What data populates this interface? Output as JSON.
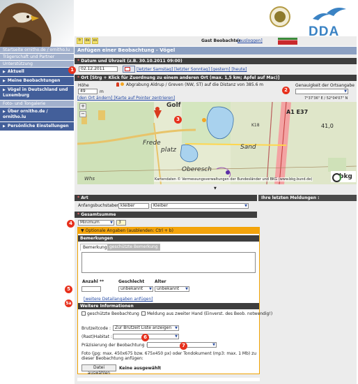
{
  "header": {
    "logo_text": "DDA"
  },
  "topbar": {
    "languages": [
      "fr",
      "de",
      "es"
    ],
    "guest_label": "Gast Beobachter",
    "logout_label": "[ausloggen]"
  },
  "sidebar": {
    "links": [
      "Startseite ornitho.de / ornitho.lu",
      "Trägerschaft und Partner",
      "Unterstützung"
    ],
    "nav1": [
      "Aktuell",
      "Meine Beobachtungen",
      "Vögel in Deutschland und Luxemburg"
    ],
    "group_label": "Foto- und Tongalerie",
    "nav2": [
      "Über ornitho.de / ornitho.lu",
      "Persönliche Einstellungen"
    ]
  },
  "page": {
    "title": "Anfügen einer Beobachtung - Vögel"
  },
  "date_section": {
    "heading": "Datum und Uhrzeit (z.B. 30.10.2011 09:00)",
    "date_value": "02.12.2011",
    "date_links": "[letzter Samstag] [letzter Sonntag] [gestern] [heute]"
  },
  "place_section": {
    "heading": "Ort [Strg + Klick für Zuordnung zu einem anderen Ort (max. 1,5 km; Apfel auf Mac)]",
    "height_label": "Höhe",
    "height_value": "49",
    "height_unit": "m",
    "location_text": "Abgrabung Aldrup / Greven (NW, ST) auf die Distanz von 385.6 m",
    "map_links": "[den Ort ändern] [Karte auf Pointer zentrieren]",
    "precision_label": "Genauigkeit der Ortsangabe",
    "coords": "7°37'36\" E / 52°04'07\" N",
    "map_labels": [
      "Golf",
      "Frede",
      "platz",
      "Sand",
      "Oberesch",
      "Whs",
      "K18",
      "A1 E37",
      "41,0"
    ],
    "map_copyright": "Kartendaten © Vermessungsverwaltungen der Bundesländer und BKG (www.bkg.bund.de)",
    "map_logo": "bkg"
  },
  "species_section": {
    "heading": "Art",
    "prefix_label": "Anfangsbuchstaben",
    "prefix_value": "kleiber",
    "species_value": "Kleiber",
    "last_reports": "Ihre letzten Meldungen :"
  },
  "count_section": {
    "heading": "Gesamtsumme",
    "mode_value": "Minimum",
    "count_value": "3"
  },
  "optional": {
    "toggle": "Optionale Angaben (ausblenden: Ctrl + b)",
    "remarks_heading": "Bemerkungen",
    "tabs": [
      "Bemerkung",
      "geschützte Bemerkung"
    ],
    "col_count": "Anzahl **",
    "col_sex": "Geschlecht",
    "col_age": "Alter",
    "sex_value": "unbekannt",
    "age_value": "unbekannt",
    "more_details": "[weitere Detailangaben anfügen]",
    "info_heading": "Weitere Informationen",
    "protected_label": "geschützte Beobachtung",
    "second_hand_label": "Meldung aus zweiter Hand (Einverst. des Beob. notwendig!)",
    "breeding_label": "Brutzeitcode :",
    "breeding_value": "Zur Brutzeit Liste anzeigen",
    "habitat_label": "(Rast)Habitat :",
    "precision_label": "Präzisierung der Beobachtung :",
    "photo_text": "Foto (jpg: max. 450x675 bzw. 675x450 px) oder Tondokument (mp3: max. 1 Mb) zu dieser Beobachtung anfügen:",
    "file_button": "Datei auswählen",
    "file_status": "Keine ausgewählt"
  },
  "markers": [
    "1",
    "2",
    "3",
    "4",
    "5",
    "5a",
    "6",
    "7"
  ],
  "colors": {
    "nav_dark": "#435f9a",
    "nav_light": "#a2b1cd",
    "section_head": "#3e3e3e",
    "optional_orange": "#f4a40c",
    "marker_red": "#e7301c",
    "link_blue": "#2147a3"
  }
}
